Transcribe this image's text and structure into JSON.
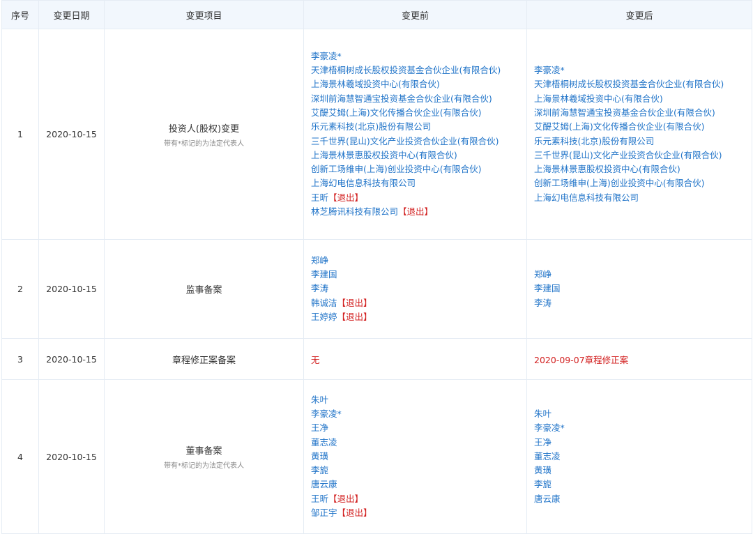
{
  "headers": [
    "序号",
    "变更日期",
    "变更项目",
    "变更前",
    "变更后"
  ],
  "exit_label": "【退出】",
  "rows": [
    {
      "no": "1",
      "date": "2020-10-15",
      "project": "投资人(股权)变更",
      "note": "带有*标记的为法定代表人",
      "before": [
        {
          "name": "李豪凌*"
        },
        {
          "name": "天津梧桐树成长股权投资基金合伙企业(有限合伙)"
        },
        {
          "name": "上海景林羲域投资中心(有限合伙)"
        },
        {
          "name": "深圳前海慧智通宝投资基金合伙企业(有限合伙)"
        },
        {
          "name": "艾醍艾姆(上海)文化传播合伙企业(有限合伙)"
        },
        {
          "name": "乐元素科技(北京)股份有限公司"
        },
        {
          "name": "三千世界(昆山)文化产业投资合伙企业(有限合伙)"
        },
        {
          "name": "上海景林景惠股权投资中心(有限合伙)"
        },
        {
          "name": "创新工场维申(上海)创业投资中心(有限合伙)"
        },
        {
          "name": "上海幻电信息科技有限公司"
        },
        {
          "name": "王昕",
          "exit": true
        },
        {
          "name": "林芝腾讯科技有限公司",
          "exit": true
        }
      ],
      "after": [
        {
          "name": "李豪凌*"
        },
        {
          "name": "天津梧桐树成长股权投资基金合伙企业(有限合伙)"
        },
        {
          "name": "上海景林羲域投资中心(有限合伙)"
        },
        {
          "name": "深圳前海慧智通宝投资基金合伙企业(有限合伙)"
        },
        {
          "name": "艾醍艾姆(上海)文化传播合伙企业(有限合伙)"
        },
        {
          "name": "乐元素科技(北京)股份有限公司"
        },
        {
          "name": "三千世界(昆山)文化产业投资合伙企业(有限合伙)"
        },
        {
          "name": "上海景林景惠股权投资中心(有限合伙)"
        },
        {
          "name": "创新工场维申(上海)创业投资中心(有限合伙)"
        },
        {
          "name": "上海幻电信息科技有限公司"
        }
      ]
    },
    {
      "no": "2",
      "date": "2020-10-15",
      "project": "监事备案",
      "note": "",
      "before": [
        {
          "name": "郑峥"
        },
        {
          "name": "李建国"
        },
        {
          "name": "李涛"
        },
        {
          "name": "韩诚洁",
          "exit": true
        },
        {
          "name": "王婷婷",
          "exit": true
        }
      ],
      "after": [
        {
          "name": "郑峥"
        },
        {
          "name": "李建国"
        },
        {
          "name": "李涛"
        }
      ]
    },
    {
      "no": "3",
      "date": "2020-10-15",
      "project": "章程修正案备案",
      "note": "",
      "before_text": "无",
      "after_text": "2020-09-07章程修正案"
    },
    {
      "no": "4",
      "date": "2020-10-15",
      "project": "董事备案",
      "note": "带有*标记的为法定代表人",
      "before": [
        {
          "name": "朱叶"
        },
        {
          "name": "李豪凌*"
        },
        {
          "name": "王净"
        },
        {
          "name": "董志凌"
        },
        {
          "name": "黄璜"
        },
        {
          "name": "李旎"
        },
        {
          "name": "唐云康"
        },
        {
          "name": "王昕",
          "exit": true
        },
        {
          "name": "邹正宇",
          "exit": true
        }
      ],
      "after": [
        {
          "name": "朱叶"
        },
        {
          "name": "李豪凌*"
        },
        {
          "name": "王净"
        },
        {
          "name": "董志凌"
        },
        {
          "name": "黄璜"
        },
        {
          "name": "李旎"
        },
        {
          "name": "唐云康"
        }
      ]
    }
  ]
}
